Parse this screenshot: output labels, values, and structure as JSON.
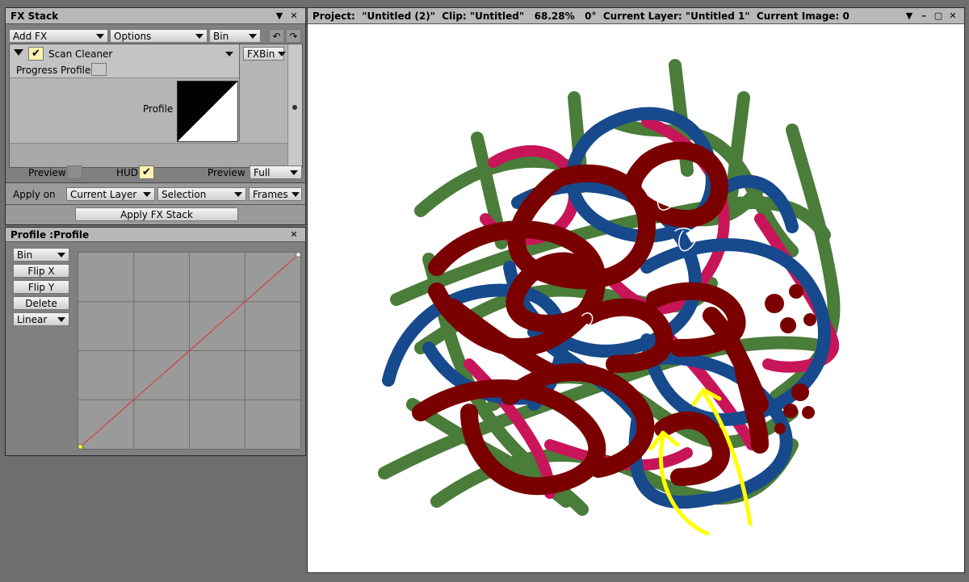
{
  "fx_stack": {
    "title": "FX Stack",
    "add_fx": "Add FX",
    "options": "Options",
    "bin": "Bin",
    "effect_name": "Scan Cleaner",
    "fxbin": "FXBin",
    "progress_profile": "Progress Profile",
    "profile_label": "Profile",
    "preview_label": "Preview",
    "hud_label": "HUD",
    "preview_mode_label": "Preview",
    "preview_mode_value": "Full",
    "apply_on_label": "Apply on",
    "apply_target": "Current Layer",
    "apply_selection": "Selection",
    "apply_frames": "Frames",
    "apply_button": "Apply FX Stack"
  },
  "profile_panel": {
    "title": "Profile :Profile",
    "bin": "Bin",
    "flip_x": "Flip X",
    "flip_y": "Flip Y",
    "delete": "Delete",
    "interpolation": "Linear"
  },
  "viewer": {
    "title": "Project:  \"Untitled (2)\"  Clip: \"Untitled\"   68.28%   0°  Current Layer: \"Untitled 1\"  Current Image: 0"
  },
  "icons": [
    "close-icon",
    "undo-icon",
    "redo-icon",
    "minimize-icon",
    "maximize-icon",
    "checkmark-icon",
    "collapse-triangle-icon"
  ],
  "colors": {
    "panel_bg": "#808080",
    "titlebar_bg": "#b8b8b8",
    "checked_bg": "#fff2b0",
    "curve_line": "#e03030",
    "stroke_green": "#4a7c3a",
    "stroke_blue": "#174a8c",
    "stroke_pink": "#c8155a",
    "stroke_darkred": "#7a0000",
    "stroke_yellow": "#ffff00"
  }
}
